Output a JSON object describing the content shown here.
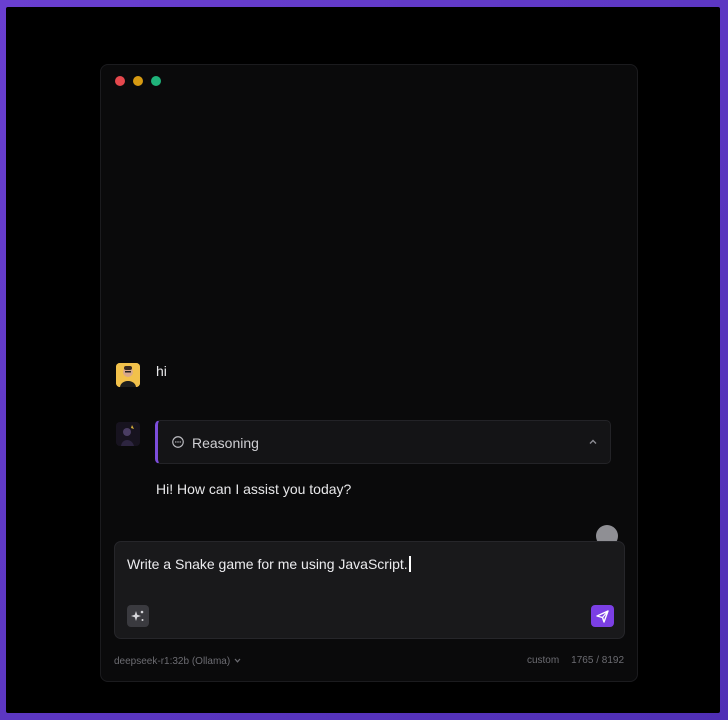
{
  "window": {
    "controls": [
      "close",
      "minimize",
      "maximize"
    ]
  },
  "messages": [
    {
      "role": "user",
      "text": "hi"
    },
    {
      "role": "assistant",
      "reasoning_label": "Reasoning",
      "text": "Hi! How can I assist you today?"
    }
  ],
  "composer": {
    "value": "Write a Snake game for me using JavaScript.",
    "tools_icon": "sparkle-icon",
    "send_icon": "send-icon"
  },
  "footer": {
    "model": "deepseek-r1:32b (Ollama)",
    "mode": "custom",
    "tokens": "1765 / 8192"
  },
  "colors": {
    "accent": "#7b3fe4",
    "background": "#0a0a0b"
  }
}
